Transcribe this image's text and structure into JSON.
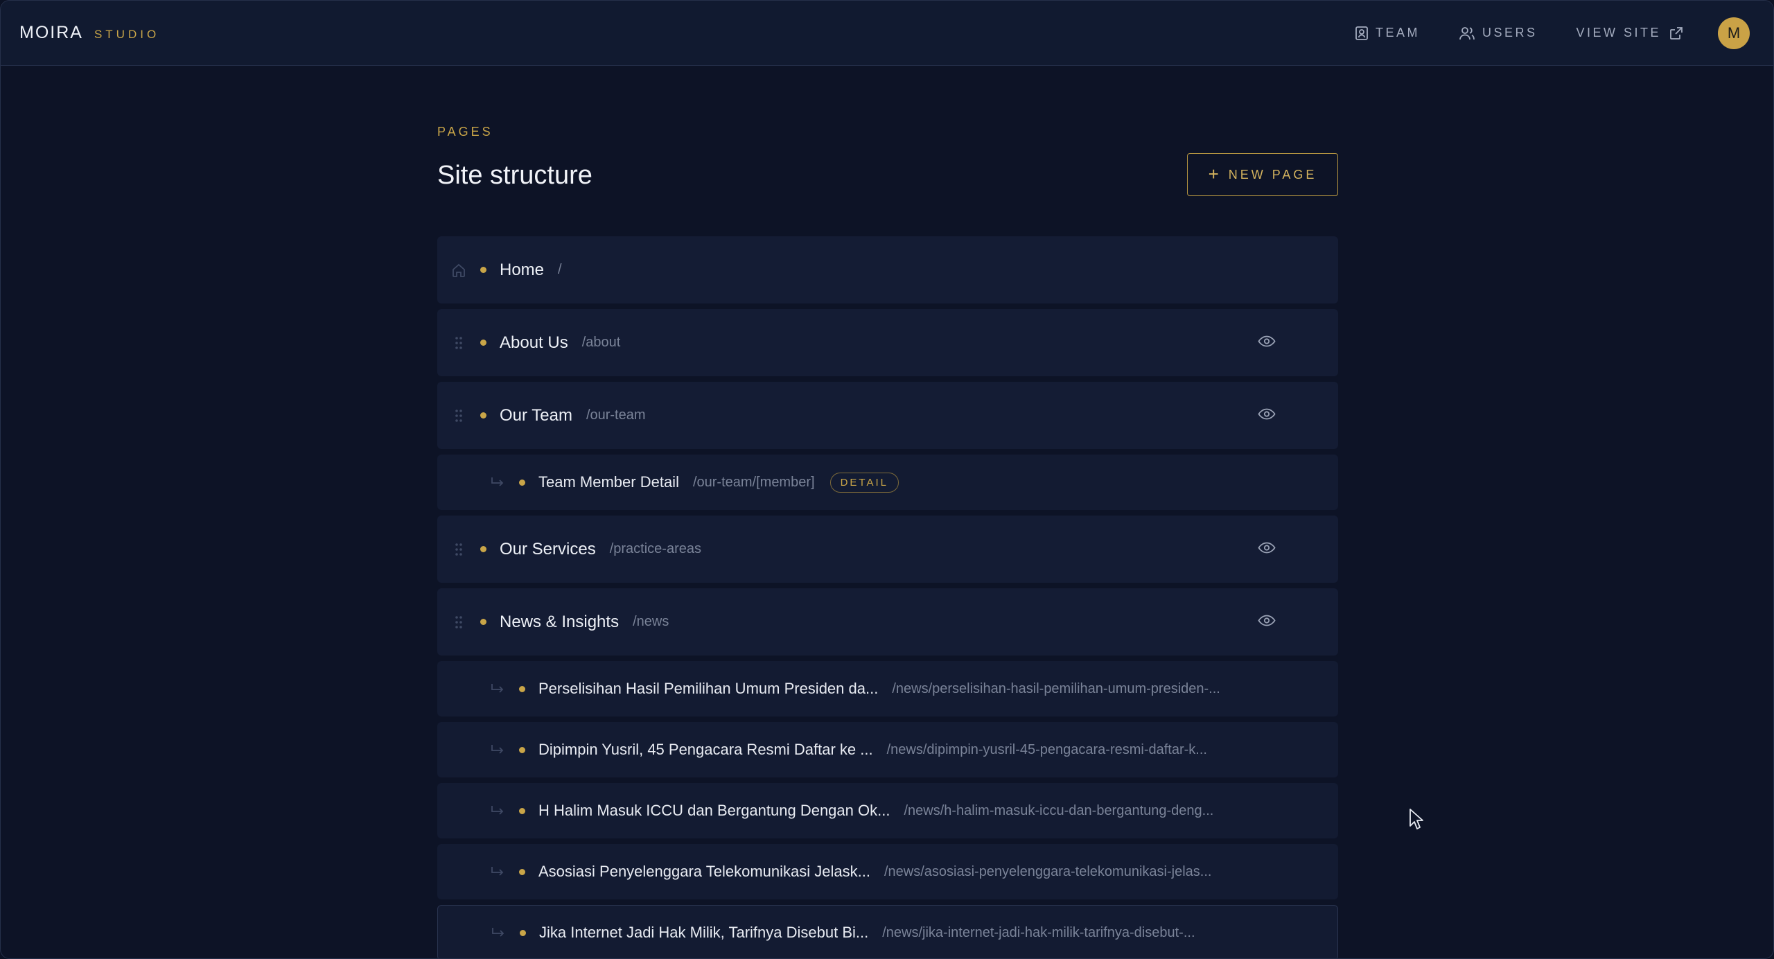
{
  "brand": {
    "name": "MOIRA",
    "sub": "STUDIO"
  },
  "nav": {
    "team": "TEAM",
    "users": "USERS",
    "view_site": "VIEW SITE",
    "avatar_initial": "M"
  },
  "header": {
    "eyebrow": "PAGES",
    "title": "Site structure",
    "new_page": "NEW PAGE"
  },
  "pages": [
    {
      "title": "Home",
      "slug": "/"
    },
    {
      "title": "About Us",
      "slug": "/about"
    },
    {
      "title": "Our Team",
      "slug": "/our-team"
    },
    {
      "title": "Team Member Detail",
      "slug": "/our-team/[member]",
      "badge": "DETAIL"
    },
    {
      "title": "Our Services",
      "slug": "/practice-areas"
    },
    {
      "title": "News & Insights",
      "slug": "/news"
    },
    {
      "title": "Perselisihan Hasil Pemilihan Umum Presiden da...",
      "slug": "/news/perselisihan-hasil-pemilihan-umum-presiden-..."
    },
    {
      "title": "Dipimpin Yusril, 45 Pengacara Resmi Daftar ke ...",
      "slug": "/news/dipimpin-yusril-45-pengacara-resmi-daftar-k..."
    },
    {
      "title": "H Halim Masuk ICCU dan Bergantung Dengan Ok...",
      "slug": "/news/h-halim-masuk-iccu-dan-bergantung-deng..."
    },
    {
      "title": "Asosiasi Penyelenggara Telekomunikasi Jelask...",
      "slug": "/news/asosiasi-penyelenggara-telekomunikasi-jelas..."
    },
    {
      "title": "Jika Internet Jadi Hak Milik, Tarifnya Disebut Bi...",
      "slug": "/news/jika-internet-jadi-hak-milik-tarifnya-disebut-..."
    }
  ],
  "colors": {
    "accent": "#c9a548",
    "background": "#0d1326",
    "row": "#141c34"
  }
}
